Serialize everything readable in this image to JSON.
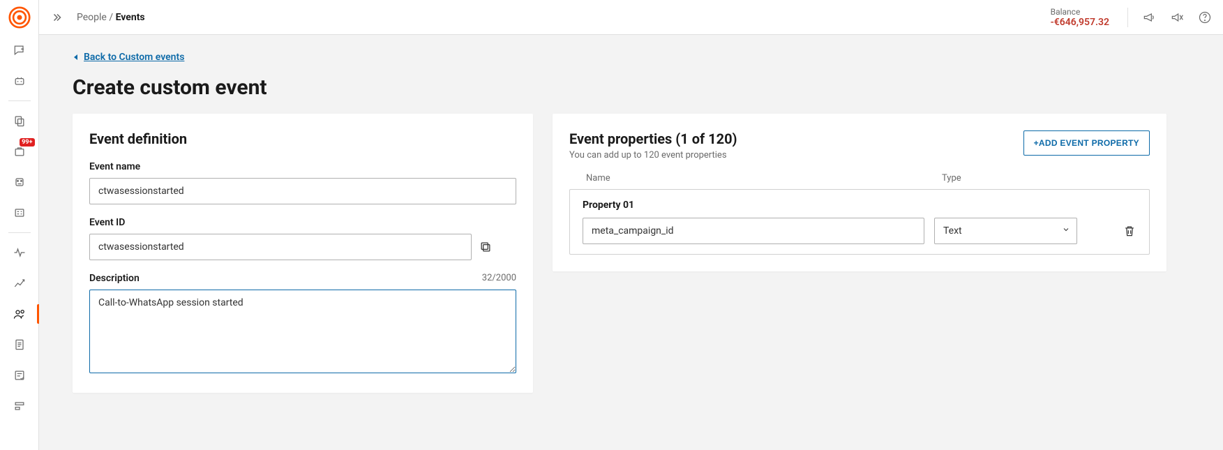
{
  "breadcrumb": {
    "parent": "People",
    "separator": "/",
    "current": "Events"
  },
  "balance": {
    "label": "Balance",
    "value": "-€646,957.32"
  },
  "sidebar_badge": "99+",
  "back_link": "Back to Custom events",
  "page_title": "Create custom event",
  "definition": {
    "heading": "Event definition",
    "name_label": "Event name",
    "name_value": "ctwasessionstarted",
    "id_label": "Event ID",
    "id_value": "ctwasessionstarted",
    "desc_label": "Description",
    "desc_counter": "32/2000",
    "desc_value": "Call-to-WhatsApp session started"
  },
  "properties": {
    "heading": "Event properties (1 of 120)",
    "hint": "You can add up to 120 event properties",
    "add_button": "+ADD EVENT PROPERTY",
    "col_name": "Name",
    "col_type": "Type",
    "items": [
      {
        "title": "Property 01",
        "name": "meta_campaign_id",
        "type": "Text"
      }
    ]
  }
}
